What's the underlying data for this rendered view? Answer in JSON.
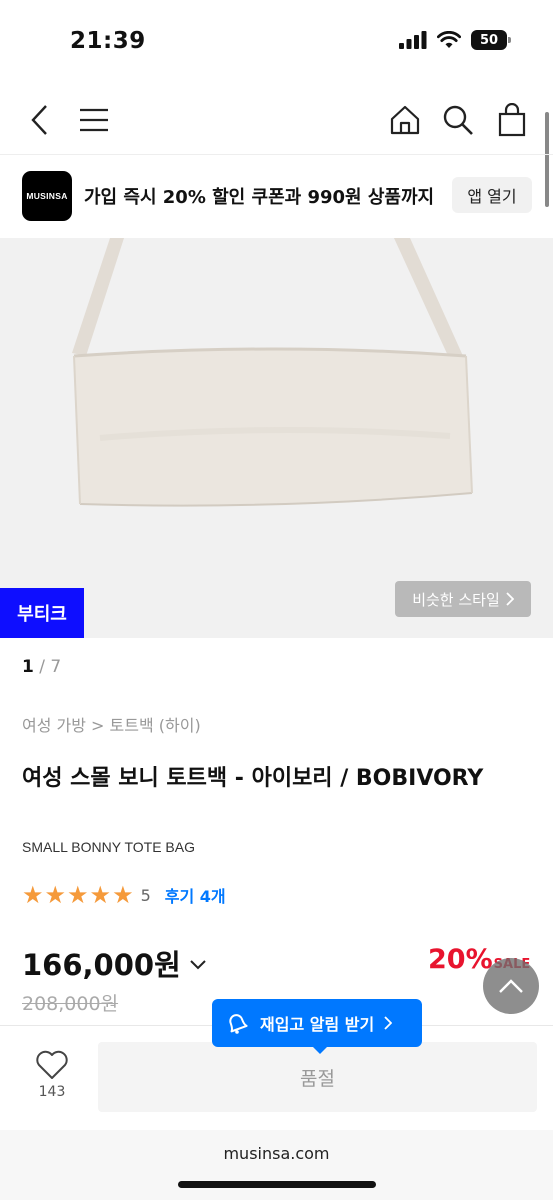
{
  "status_bar": {
    "time": "21:39",
    "battery": "50"
  },
  "banner": {
    "logo_text": "MUSINSA",
    "text": "가입 즉시 20% 할인 쿠폰과 990원 상품까지",
    "open_label": "앱 열기"
  },
  "gallery": {
    "badge": "부티크",
    "similar_style_label": "비슷한 스타일",
    "current_page": "1",
    "page_separator": "/",
    "total_pages": "7"
  },
  "product": {
    "breadcrumb": "여성 가방 > 토트백 (하이)",
    "title": "여성 스몰 보니 토트백 - 아이보리 / BOBIVORY",
    "subtitle": "SMALL BONNY TOTE BAG",
    "rating": "5",
    "stars": 5,
    "review_label": "후기 4개",
    "price": "166,000원",
    "original_price": "208,000원",
    "discount_rate": "20%",
    "discount_label": "SALE"
  },
  "purchase": {
    "restock_label": "재입고 알림 받기",
    "like_count": "143",
    "soldout_label": "품절"
  },
  "browser": {
    "url": "musinsa.com"
  },
  "colors": {
    "accent_blue": "#0078ff",
    "badge_blue": "#0e0eff",
    "sale_red": "#e8142e",
    "star_orange": "#f59a3b"
  }
}
